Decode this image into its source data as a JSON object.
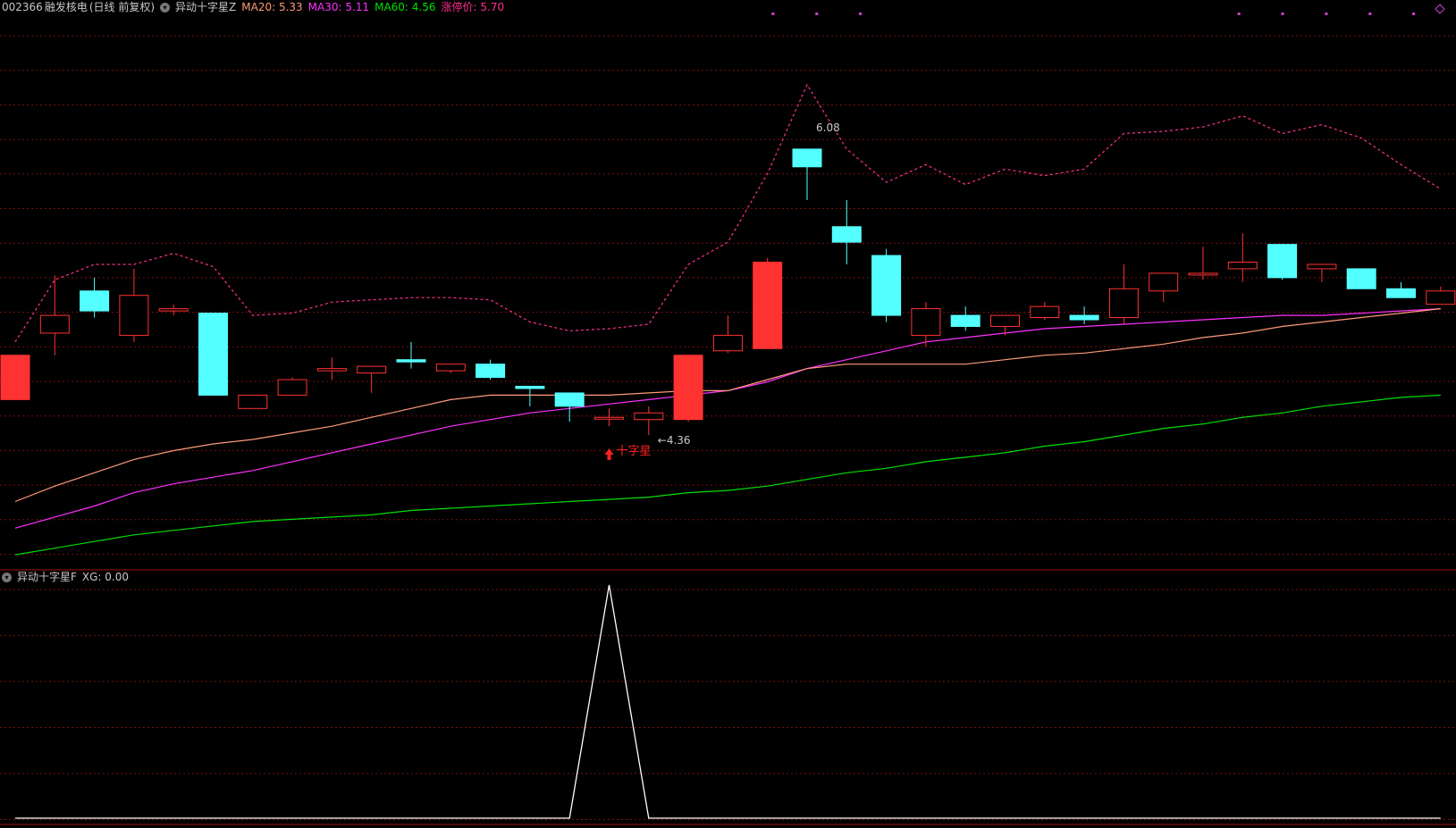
{
  "main_header": {
    "code": "002366",
    "name": "融发核电",
    "period": "(日线 前复权)",
    "indicator": "异动十字星Z",
    "ma20_label": "MA20:",
    "ma20_value": "5.33",
    "ma30_label": "MA30:",
    "ma30_value": "5.11",
    "ma60_label": "MA60:",
    "ma60_value": "4.56",
    "limit_label": "涨停价:",
    "limit_value": "5.70"
  },
  "sub_header": {
    "indicator": "异动十字星F",
    "xg_label": "XG:",
    "xg_value": "0.00"
  },
  "annotations": {
    "high_label": "6.08",
    "low_label": "←4.36",
    "signal_label": "十字星",
    "signal_icon": "up-arrow"
  },
  "colors": {
    "up": "#ff3232",
    "down": "#54ffff",
    "ma20": "#ff9a7a",
    "ma30": "#ff30ff",
    "ma60": "#00e000",
    "limit": "#ff3090",
    "grid": "#7a1010",
    "xg": "#ffffff"
  },
  "chart_data": {
    "type": "candlestick",
    "ohlc": [
      {
        "o": 4.54,
        "h": 4.72,
        "l": 4.54,
        "c": 4.74
      },
      {
        "o": 4.84,
        "h": 5.1,
        "l": 4.74,
        "c": 4.92
      },
      {
        "o": 5.03,
        "h": 5.09,
        "l": 4.91,
        "c": 4.94
      },
      {
        "o": 4.83,
        "h": 5.13,
        "l": 4.8,
        "c": 5.01
      },
      {
        "o": 4.94,
        "h": 4.97,
        "l": 4.92,
        "c": 4.95
      },
      {
        "o": 4.93,
        "h": 4.93,
        "l": 4.56,
        "c": 4.56
      },
      {
        "o": 4.5,
        "h": 4.53,
        "l": 4.5,
        "c": 4.56
      },
      {
        "o": 4.56,
        "h": 4.64,
        "l": 4.57,
        "c": 4.63
      },
      {
        "o": 4.67,
        "h": 4.73,
        "l": 4.63,
        "c": 4.68
      },
      {
        "o": 4.66,
        "h": 4.69,
        "l": 4.57,
        "c": 4.69
      },
      {
        "o": 4.72,
        "h": 4.8,
        "l": 4.68,
        "c": 4.71
      },
      {
        "o": 4.67,
        "h": 4.7,
        "l": 4.66,
        "c": 4.7
      },
      {
        "o": 4.7,
        "h": 4.72,
        "l": 4.63,
        "c": 4.64
      },
      {
        "o": 4.6,
        "h": 4.6,
        "l": 4.51,
        "c": 4.59
      },
      {
        "o": 4.57,
        "h": 4.57,
        "l": 4.44,
        "c": 4.51
      },
      {
        "o": 4.46,
        "h": 4.5,
        "l": 4.42,
        "c": 4.46
      },
      {
        "o": 4.45,
        "h": 4.51,
        "l": 4.38,
        "c": 4.48
      },
      {
        "o": 4.45,
        "h": 4.74,
        "l": 4.44,
        "c": 4.74
      },
      {
        "o": 4.76,
        "h": 4.92,
        "l": 4.75,
        "c": 4.83
      },
      {
        "o": 4.77,
        "h": 5.18,
        "l": 4.77,
        "c": 5.16
      },
      {
        "o": 5.67,
        "h": 5.67,
        "l": 5.44,
        "c": 5.59
      },
      {
        "o": 5.32,
        "h": 5.44,
        "l": 5.15,
        "c": 5.25
      },
      {
        "o": 5.19,
        "h": 5.22,
        "l": 4.89,
        "c": 4.92
      },
      {
        "o": 4.83,
        "h": 4.98,
        "l": 4.78,
        "c": 4.95
      },
      {
        "o": 4.92,
        "h": 4.96,
        "l": 4.85,
        "c": 4.87
      },
      {
        "o": 4.87,
        "h": 4.92,
        "l": 4.83,
        "c": 4.92
      },
      {
        "o": 4.91,
        "h": 4.98,
        "l": 4.9,
        "c": 4.96
      },
      {
        "o": 4.92,
        "h": 4.96,
        "l": 4.88,
        "c": 4.9
      },
      {
        "o": 4.91,
        "h": 5.15,
        "l": 4.88,
        "c": 5.04
      },
      {
        "o": 5.03,
        "h": 5.07,
        "l": 4.98,
        "c": 5.11
      },
      {
        "o": 5.11,
        "h": 5.23,
        "l": 5.08,
        "c": 5.11
      },
      {
        "o": 5.13,
        "h": 5.29,
        "l": 5.07,
        "c": 5.16
      },
      {
        "o": 5.24,
        "h": 5.24,
        "l": 5.08,
        "c": 5.09
      },
      {
        "o": 5.13,
        "h": 5.15,
        "l": 5.07,
        "c": 5.15
      },
      {
        "o": 5.13,
        "h": 5.13,
        "l": 5.04,
        "c": 5.04
      },
      {
        "o": 5.04,
        "h": 5.07,
        "l": 5.0,
        "c": 5.0
      },
      {
        "o": 4.97,
        "h": 5.05,
        "l": 4.97,
        "c": 5.03
      }
    ],
    "ma20": [
      4.08,
      4.15,
      4.21,
      4.27,
      4.31,
      4.34,
      4.36,
      4.39,
      4.42,
      4.46,
      4.5,
      4.54,
      4.56,
      4.56,
      4.56,
      4.56,
      4.57,
      4.58,
      4.58,
      4.63,
      4.68,
      4.7,
      4.7,
      4.7,
      4.7,
      4.72,
      4.74,
      4.75,
      4.77,
      4.79,
      4.82,
      4.84,
      4.87,
      4.89,
      4.91,
      4.93,
      4.95
    ],
    "ma30": [
      3.96,
      4.01,
      4.06,
      4.12,
      4.16,
      4.19,
      4.22,
      4.26,
      4.3,
      4.34,
      4.38,
      4.42,
      4.45,
      4.48,
      4.5,
      4.52,
      4.54,
      4.56,
      4.58,
      4.62,
      4.68,
      4.72,
      4.76,
      4.8,
      4.82,
      4.84,
      4.86,
      4.87,
      4.88,
      4.89,
      4.9,
      4.91,
      4.92,
      4.92,
      4.93,
      4.94,
      4.95
    ],
    "ma60": [
      3.84,
      3.87,
      3.9,
      3.93,
      3.95,
      3.97,
      3.99,
      4.0,
      4.01,
      4.02,
      4.04,
      4.05,
      4.06,
      4.07,
      4.08,
      4.09,
      4.1,
      4.12,
      4.13,
      4.15,
      4.18,
      4.21,
      4.23,
      4.26,
      4.28,
      4.3,
      4.33,
      4.35,
      4.38,
      4.41,
      4.43,
      4.46,
      4.48,
      4.51,
      4.53,
      4.55,
      4.56
    ],
    "limit": [
      4.8,
      5.08,
      5.15,
      5.15,
      5.2,
      5.14,
      4.92,
      4.93,
      4.98,
      4.99,
      5.0,
      5.0,
      4.99,
      4.89,
      4.85,
      4.86,
      4.88,
      5.15,
      5.25,
      5.56,
      5.96,
      5.67,
      5.52,
      5.6,
      5.51,
      5.58,
      5.55,
      5.58,
      5.74,
      5.75,
      5.77,
      5.82,
      5.74,
      5.78,
      5.72,
      5.6,
      5.49
    ],
    "xg": [
      0,
      0,
      0,
      0,
      0,
      0,
      0,
      0,
      0,
      0,
      0,
      0,
      0,
      0,
      0,
      1,
      0,
      0,
      0,
      0,
      0,
      0,
      0,
      0,
      0,
      0,
      0,
      0,
      0,
      0,
      0,
      0,
      0,
      0,
      0,
      0,
      0
    ]
  }
}
